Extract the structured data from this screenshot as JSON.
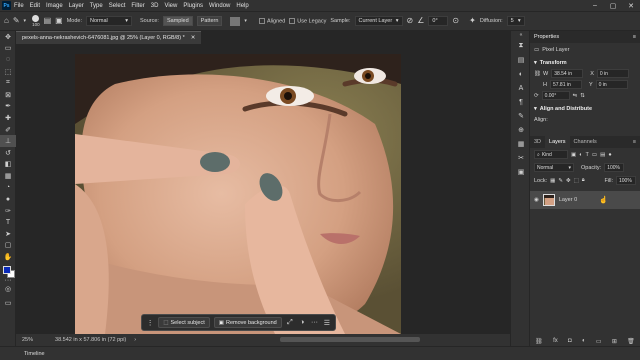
{
  "app": {
    "logo": "Ps"
  },
  "menu": [
    "File",
    "Edit",
    "Image",
    "Layer",
    "Type",
    "Select",
    "Filter",
    "3D",
    "View",
    "Plugins",
    "Window",
    "Help"
  ],
  "window_controls": {
    "minimize": "–",
    "maximize": "▢",
    "close": "✕"
  },
  "options": {
    "brush_size": "100",
    "mode_label": "Mode:",
    "mode_value": "Normal",
    "source_label": "Source:",
    "source_sampled": "Sampled",
    "source_pattern": "Pattern",
    "aligned_label": "Aligned",
    "use_legacy_label": "Use Legacy",
    "sample_label": "Sample:",
    "sample_value": "Current Layer",
    "angle_value": "0°",
    "diffusion_label": "Diffusion:",
    "diffusion_value": "5"
  },
  "document_tab": {
    "title": "pexels-anna-nekrashevich-6476081.jpg @ 25% (Layer 0, RGB/8) *",
    "close": "✕"
  },
  "context_bar": {
    "select_subject": "Select subject",
    "remove_background": "Remove background",
    "more": "···"
  },
  "status": {
    "zoom": "25%",
    "dimensions": "38.542 in x 57.806 in (72 ppi)"
  },
  "timeline": {
    "label": "Timeline"
  },
  "properties": {
    "tab": "Properties",
    "kind": "Pixel Layer",
    "transform_label": "Transform",
    "w_label": "W",
    "w_value": "38.54 in",
    "h_label": "H",
    "h_value": "57.81 in",
    "x_label": "X",
    "x_value": "0 in",
    "y_label": "Y",
    "y_value": "0 in",
    "angle_value": "0.00°",
    "align_label": "Align and Distribute",
    "align_sub": "Align:"
  },
  "layers_panel": {
    "tabs": [
      "3D",
      "Layers",
      "Channels"
    ],
    "kind_filter": "Kind",
    "blend_mode": "Normal",
    "opacity_label": "Opacity:",
    "opacity_value": "100%",
    "lock_label": "Lock:",
    "fill_label": "Fill:",
    "fill_value": "100%",
    "layer_name": "Layer 0"
  },
  "colors": {
    "foreground": "#0a2ab8",
    "background": "#ffffff",
    "accent": "#31a8ff"
  }
}
